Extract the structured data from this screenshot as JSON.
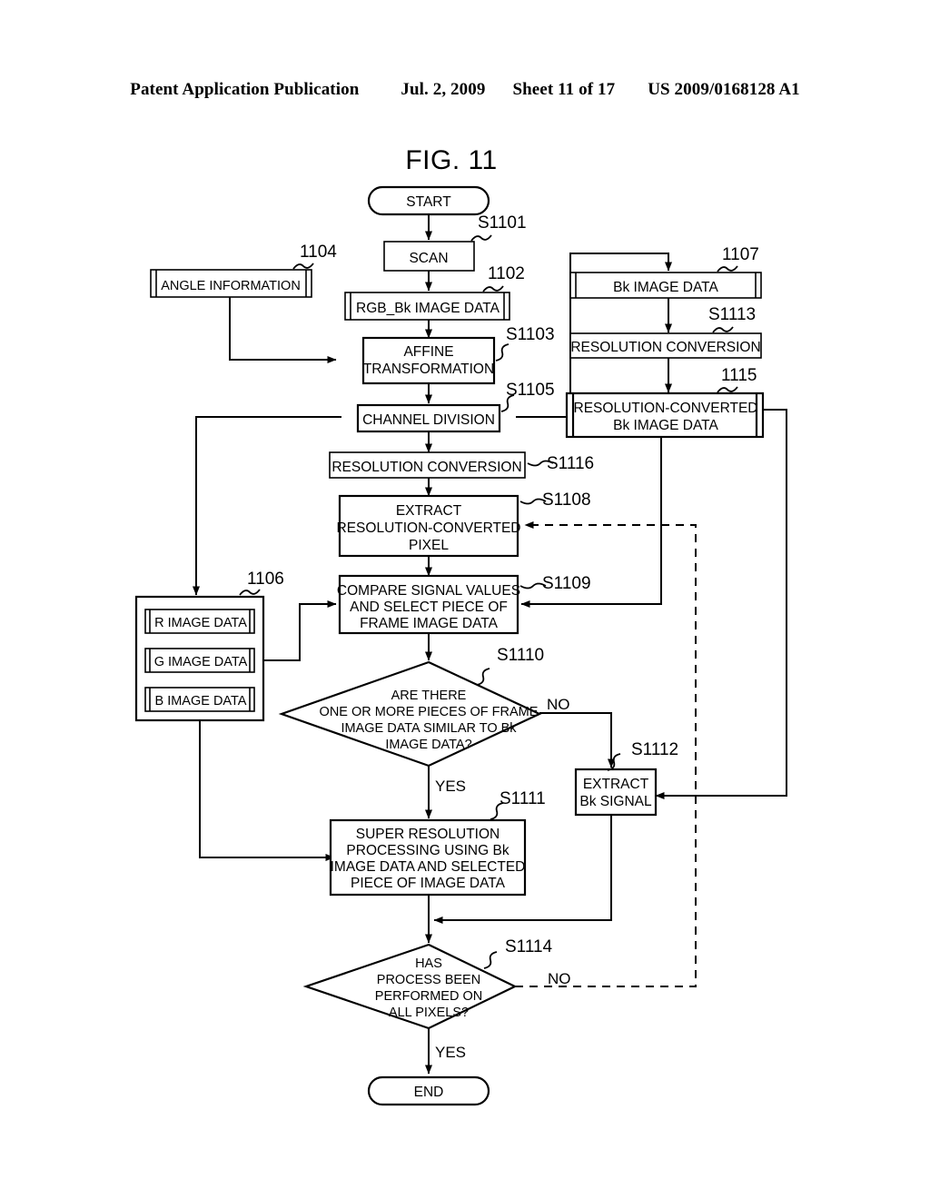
{
  "header": {
    "publication": "Patent Application Publication",
    "date": "Jul. 2, 2009",
    "sheet": "Sheet 11 of 17",
    "number": "US 2009/0168128 A1"
  },
  "figure": {
    "title": "FIG. 11"
  },
  "nodes": {
    "start": "START",
    "end": "END",
    "scan": "SCAN",
    "rgb_bk_image_data": "RGB_Bk IMAGE DATA",
    "angle_information": "ANGLE INFORMATION",
    "affine_transformation_line1": "AFFINE",
    "affine_transformation_line2": "TRANSFORMATION",
    "channel_division": "CHANNEL DIVISION",
    "resolution_conversion_main": "RESOLUTION CONVERSION",
    "extract_pixel_line1": "EXTRACT",
    "extract_pixel_line2": "RESOLUTION-CONVERTED",
    "extract_pixel_line3": "PIXEL",
    "compare_line1": "COMPARE SIGNAL VALUES",
    "compare_line2": "AND SELECT PIECE OF",
    "compare_line3": "FRAME IMAGE DATA",
    "decision_similar_line1": "ARE THERE",
    "decision_similar_line2": "ONE OR MORE PIECES OF FRAME",
    "decision_similar_line3": "IMAGE DATA SIMILAR TO Bk",
    "decision_similar_line4": "IMAGE DATA?",
    "super_resolution_line1": "SUPER RESOLUTION",
    "super_resolution_line2": "PROCESSING USING Bk",
    "super_resolution_line3": "IMAGE DATA AND SELECTED",
    "super_resolution_line4": "PIECE OF IMAGE DATA",
    "decision_allpixels_line1": "HAS",
    "decision_allpixels_line2": "PROCESS BEEN",
    "decision_allpixels_line3": "PERFORMED ON",
    "decision_allpixels_line4": "ALL PIXELS?",
    "extract_bk_signal_line1": "EXTRACT",
    "extract_bk_signal_line2": "Bk SIGNAL",
    "bk_image_data": "Bk IMAGE DATA",
    "resolution_conversion_bk": "RESOLUTION CONVERSION",
    "resolution_converted_line1": "RESOLUTION-CONVERTED",
    "resolution_converted_line2": "Bk IMAGE DATA",
    "r_image_data": "R IMAGE DATA",
    "g_image_data": "G IMAGE DATA",
    "b_image_data": "B IMAGE DATA"
  },
  "reference_labels": {
    "s1101": "S1101",
    "s1102": "1102",
    "s1103": "S1103",
    "s1104": "1104",
    "s1105": "S1105",
    "s1106": "1106",
    "s1107": "1107",
    "s1108": "S1108",
    "s1109": "S1109",
    "s1110": "S1110",
    "s1111": "S1111",
    "s1112": "S1112",
    "s1113": "S1113",
    "s1114": "S1114",
    "s1115": "1115",
    "s1116": "S1116"
  },
  "branches": {
    "no_similar": "NO",
    "yes_similar": "YES",
    "no_allpixels": "NO",
    "yes_allpixels": "YES"
  },
  "colors": {
    "ink": "#000000",
    "paper": "#ffffff"
  }
}
